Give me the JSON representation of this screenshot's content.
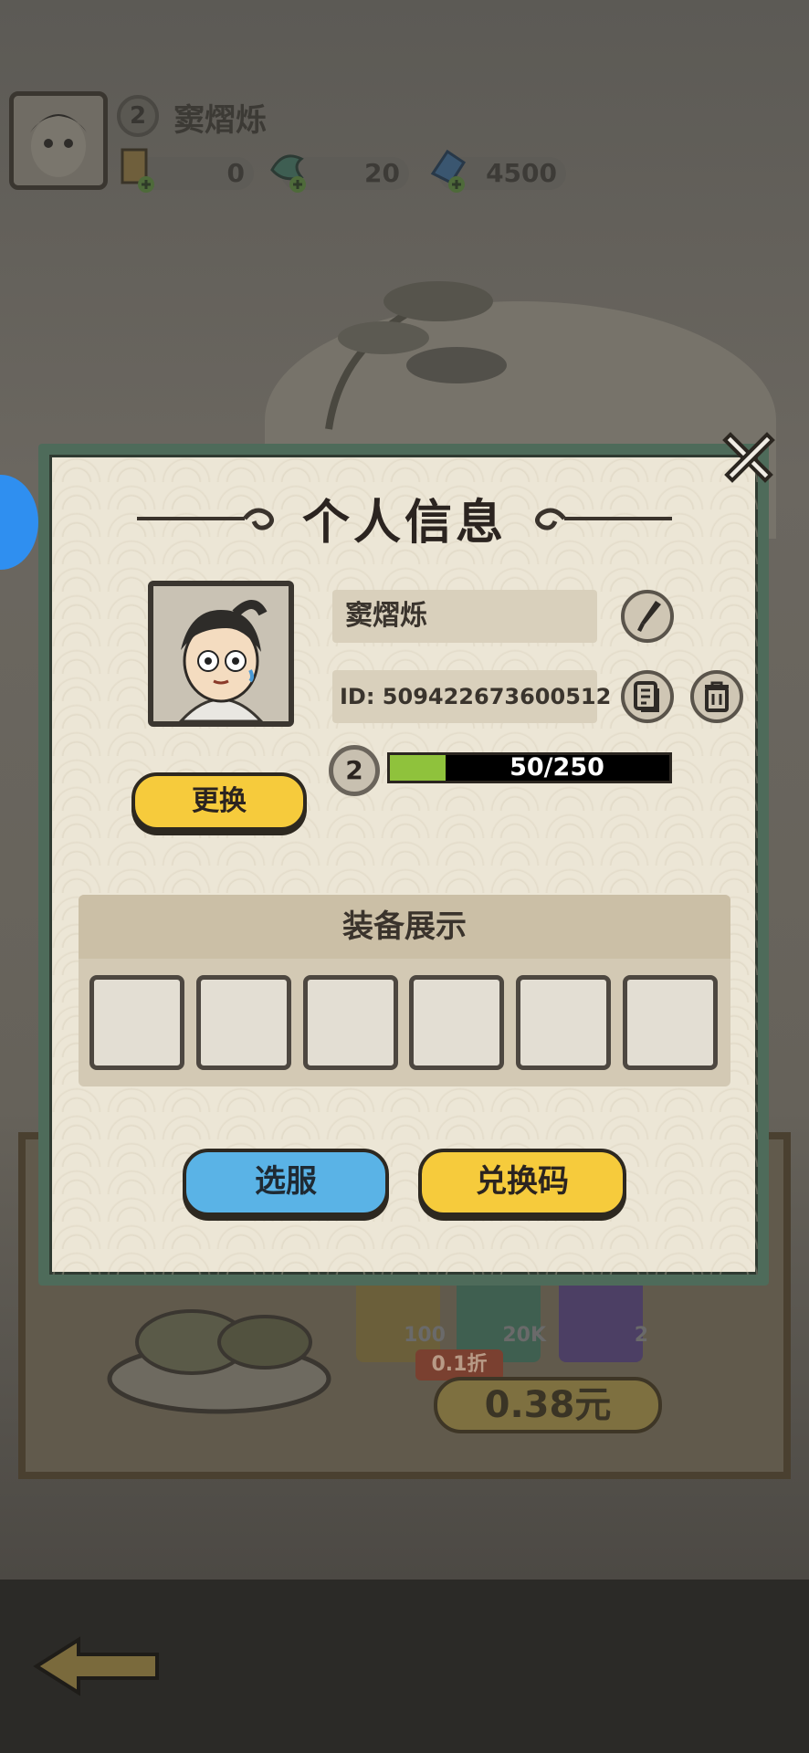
{
  "hud": {
    "level": "2",
    "player_name": "窦熠烁",
    "resources": [
      {
        "icon": "gold-ingot-icon",
        "value": "0"
      },
      {
        "icon": "jade-dragon-icon",
        "value": "20"
      },
      {
        "icon": "blue-crystal-icon",
        "value": "4500"
      }
    ]
  },
  "dialog": {
    "title": "个人信息",
    "name": "窦熠烁",
    "id_text": "ID: 509422673600512",
    "change_button": "更换",
    "level": "2",
    "xp_text": "50/250",
    "xp_progress": 0.2,
    "equip_title": "装备展示",
    "server_button": "选服",
    "redeem_button": "兑换码"
  },
  "background_shop": {
    "items": [
      "100",
      "20K",
      "2"
    ],
    "discount": "0.1折",
    "price": "0.38元"
  },
  "colors": {
    "frame_green": "#4e6b5a",
    "button_yellow": "#f6cb3c",
    "button_blue": "#5ab3e6",
    "xp_green": "#8fc23c"
  }
}
